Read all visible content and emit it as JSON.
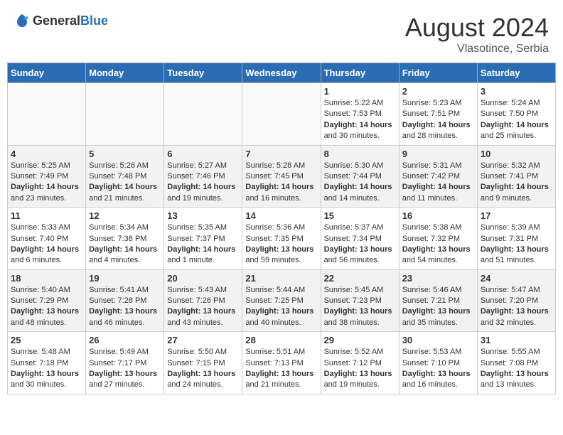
{
  "header": {
    "logo_general": "General",
    "logo_blue": "Blue",
    "month_year": "August 2024",
    "location": "Vlasotince, Serbia"
  },
  "days_of_week": [
    "Sunday",
    "Monday",
    "Tuesday",
    "Wednesday",
    "Thursday",
    "Friday",
    "Saturday"
  ],
  "weeks": [
    [
      {
        "day": "",
        "info": ""
      },
      {
        "day": "",
        "info": ""
      },
      {
        "day": "",
        "info": ""
      },
      {
        "day": "",
        "info": ""
      },
      {
        "day": "1",
        "info": "Sunrise: 5:22 AM\nSunset: 7:53 PM\nDaylight: 14 hours\nand 30 minutes."
      },
      {
        "day": "2",
        "info": "Sunrise: 5:23 AM\nSunset: 7:51 PM\nDaylight: 14 hours\nand 28 minutes."
      },
      {
        "day": "3",
        "info": "Sunrise: 5:24 AM\nSunset: 7:50 PM\nDaylight: 14 hours\nand 25 minutes."
      }
    ],
    [
      {
        "day": "4",
        "info": "Sunrise: 5:25 AM\nSunset: 7:49 PM\nDaylight: 14 hours\nand 23 minutes."
      },
      {
        "day": "5",
        "info": "Sunrise: 5:26 AM\nSunset: 7:48 PM\nDaylight: 14 hours\nand 21 minutes."
      },
      {
        "day": "6",
        "info": "Sunrise: 5:27 AM\nSunset: 7:46 PM\nDaylight: 14 hours\nand 19 minutes."
      },
      {
        "day": "7",
        "info": "Sunrise: 5:28 AM\nSunset: 7:45 PM\nDaylight: 14 hours\nand 16 minutes."
      },
      {
        "day": "8",
        "info": "Sunrise: 5:30 AM\nSunset: 7:44 PM\nDaylight: 14 hours\nand 14 minutes."
      },
      {
        "day": "9",
        "info": "Sunrise: 5:31 AM\nSunset: 7:42 PM\nDaylight: 14 hours\nand 11 minutes."
      },
      {
        "day": "10",
        "info": "Sunrise: 5:32 AM\nSunset: 7:41 PM\nDaylight: 14 hours\nand 9 minutes."
      }
    ],
    [
      {
        "day": "11",
        "info": "Sunrise: 5:33 AM\nSunset: 7:40 PM\nDaylight: 14 hours\nand 6 minutes."
      },
      {
        "day": "12",
        "info": "Sunrise: 5:34 AM\nSunset: 7:38 PM\nDaylight: 14 hours\nand 4 minutes."
      },
      {
        "day": "13",
        "info": "Sunrise: 5:35 AM\nSunset: 7:37 PM\nDaylight: 14 hours\nand 1 minute."
      },
      {
        "day": "14",
        "info": "Sunrise: 5:36 AM\nSunset: 7:35 PM\nDaylight: 13 hours\nand 59 minutes."
      },
      {
        "day": "15",
        "info": "Sunrise: 5:37 AM\nSunset: 7:34 PM\nDaylight: 13 hours\nand 56 minutes."
      },
      {
        "day": "16",
        "info": "Sunrise: 5:38 AM\nSunset: 7:32 PM\nDaylight: 13 hours\nand 54 minutes."
      },
      {
        "day": "17",
        "info": "Sunrise: 5:39 AM\nSunset: 7:31 PM\nDaylight: 13 hours\nand 51 minutes."
      }
    ],
    [
      {
        "day": "18",
        "info": "Sunrise: 5:40 AM\nSunset: 7:29 PM\nDaylight: 13 hours\nand 48 minutes."
      },
      {
        "day": "19",
        "info": "Sunrise: 5:41 AM\nSunset: 7:28 PM\nDaylight: 13 hours\nand 46 minutes."
      },
      {
        "day": "20",
        "info": "Sunrise: 5:43 AM\nSunset: 7:26 PM\nDaylight: 13 hours\nand 43 minutes."
      },
      {
        "day": "21",
        "info": "Sunrise: 5:44 AM\nSunset: 7:25 PM\nDaylight: 13 hours\nand 40 minutes."
      },
      {
        "day": "22",
        "info": "Sunrise: 5:45 AM\nSunset: 7:23 PM\nDaylight: 13 hours\nand 38 minutes."
      },
      {
        "day": "23",
        "info": "Sunrise: 5:46 AM\nSunset: 7:21 PM\nDaylight: 13 hours\nand 35 minutes."
      },
      {
        "day": "24",
        "info": "Sunrise: 5:47 AM\nSunset: 7:20 PM\nDaylight: 13 hours\nand 32 minutes."
      }
    ],
    [
      {
        "day": "25",
        "info": "Sunrise: 5:48 AM\nSunset: 7:18 PM\nDaylight: 13 hours\nand 30 minutes."
      },
      {
        "day": "26",
        "info": "Sunrise: 5:49 AM\nSunset: 7:17 PM\nDaylight: 13 hours\nand 27 minutes."
      },
      {
        "day": "27",
        "info": "Sunrise: 5:50 AM\nSunset: 7:15 PM\nDaylight: 13 hours\nand 24 minutes."
      },
      {
        "day": "28",
        "info": "Sunrise: 5:51 AM\nSunset: 7:13 PM\nDaylight: 13 hours\nand 21 minutes."
      },
      {
        "day": "29",
        "info": "Sunrise: 5:52 AM\nSunset: 7:12 PM\nDaylight: 13 hours\nand 19 minutes."
      },
      {
        "day": "30",
        "info": "Sunrise: 5:53 AM\nSunset: 7:10 PM\nDaylight: 13 hours\nand 16 minutes."
      },
      {
        "day": "31",
        "info": "Sunrise: 5:55 AM\nSunset: 7:08 PM\nDaylight: 13 hours\nand 13 minutes."
      }
    ]
  ]
}
